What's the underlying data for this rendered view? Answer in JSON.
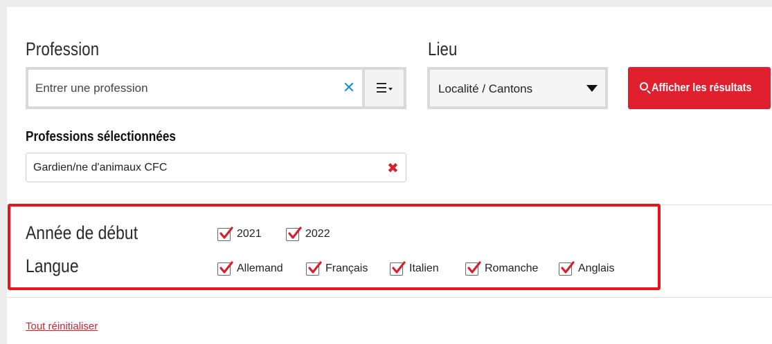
{
  "search": {
    "profession_label": "Profession",
    "profession_placeholder": "Entrer une profession",
    "lieu_label": "Lieu",
    "lieu_value": "Localité / Cantons",
    "submit_label": "Afficher les résultats"
  },
  "selected": {
    "title": "Professions sélectionnées",
    "items": [
      {
        "label": "Gardien/ne d'animaux CFC"
      }
    ]
  },
  "filters": {
    "year": {
      "label": "Année de début",
      "options": [
        {
          "label": "2021",
          "checked": true
        },
        {
          "label": "2022",
          "checked": true
        }
      ]
    },
    "language": {
      "label": "Langue",
      "options": [
        {
          "label": "Allemand",
          "checked": true
        },
        {
          "label": "Français",
          "checked": true
        },
        {
          "label": "Italien",
          "checked": true
        },
        {
          "label": "Romanche",
          "checked": true
        },
        {
          "label": "Anglais",
          "checked": true
        }
      ]
    }
  },
  "footer": {
    "reset_label": "Tout réinitialiser"
  },
  "colors": {
    "accent": "#e0202f",
    "clear_icon": "#1a8fd6",
    "highlight_border": "#e8141c"
  },
  "icons": {
    "clear": "close-icon",
    "list": "list-icon",
    "dropdown": "caret-down-icon",
    "search": "search-icon",
    "remove": "close-icon",
    "checkbox": "checkmark-icon"
  }
}
